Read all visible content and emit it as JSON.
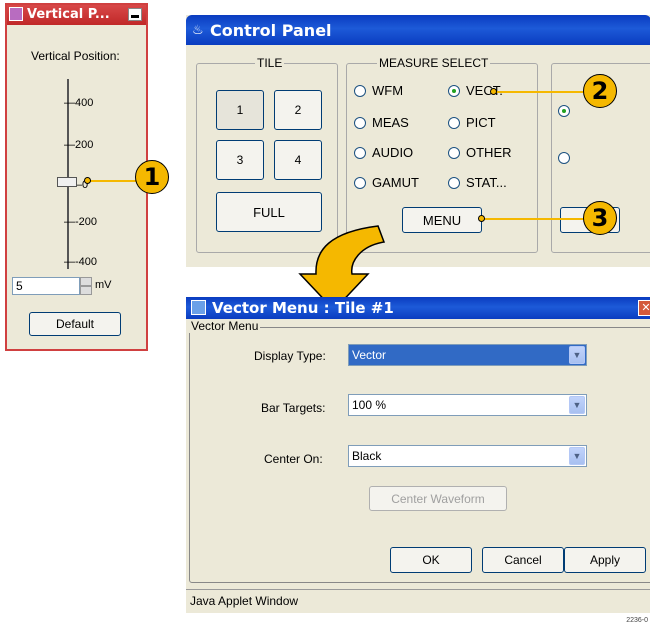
{
  "vertical_window": {
    "title": "Vertical P...",
    "label": "Vertical Position:",
    "ticks": [
      "—400",
      "—200",
      "—0",
      "—-200",
      "—-400"
    ],
    "value": "5",
    "unit": "mV",
    "default_label": "Default",
    "slider_level": 0
  },
  "control_panel": {
    "title": "Control Panel",
    "tile_legend": "TILE",
    "tiles": [
      "1",
      "2",
      "3",
      "4"
    ],
    "full_label": "FULL",
    "measure_legend": "MEASURE SELECT",
    "radios": [
      {
        "label": "WFM",
        "selected": false
      },
      {
        "label": "VECT.",
        "selected": true
      },
      {
        "label": "MEAS",
        "selected": false
      },
      {
        "label": "PICT",
        "selected": false
      },
      {
        "label": "AUDIO",
        "selected": false
      },
      {
        "label": "OTHER",
        "selected": false
      },
      {
        "label": "GAMUT",
        "selected": false
      },
      {
        "label": "STAT...",
        "selected": false
      }
    ],
    "menu_label": "MENU"
  },
  "vector_menu": {
    "title": "Vector Menu : Tile #1",
    "group_legend": "Vector Menu",
    "display_type_label": "Display Type:",
    "display_type_value": "Vector",
    "bar_targets_label": "Bar Targets:",
    "bar_targets_value": "100 %",
    "center_on_label": "Center On:",
    "center_on_value": "Black",
    "center_waveform_label": "Center Waveform",
    "ok_label": "OK",
    "cancel_label": "Cancel",
    "apply_label": "Apply",
    "status_text": "Java Applet Window"
  },
  "callouts": [
    "1",
    "2",
    "3"
  ],
  "figure_id": "2236-0",
  "colors": {
    "callout": "#f5b800",
    "titlebar": "#0a3cc0",
    "accent_arrow": "#f5b800",
    "selection": "#316ac5"
  }
}
